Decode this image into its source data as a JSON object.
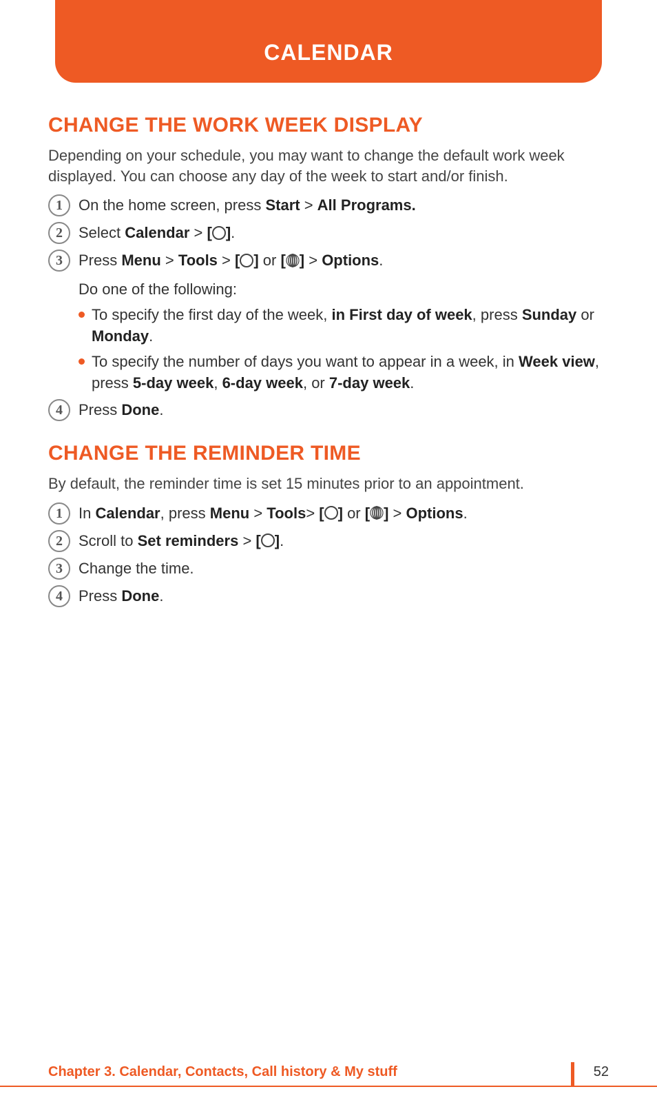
{
  "header": {
    "title": "CALENDAR"
  },
  "section1": {
    "title": "CHANGE THE WORK WEEK DISPLAY",
    "intro": "Depending on your schedule, you may want to change the default work week displayed. You can choose any day of the week to start and/or finish.",
    "steps": {
      "s1": {
        "num": "1",
        "pre": "On the home screen, press ",
        "b1": "Start",
        "mid": " > ",
        "b2": "All Programs."
      },
      "s2": {
        "num": "2",
        "pre": "Select ",
        "b1": "Calendar",
        "mid": " > ",
        "lb": "[",
        "rb": "]",
        "post": "."
      },
      "s3": {
        "num": "3",
        "pre": "Press ",
        "b1": "Menu",
        "g1": " > ",
        "b2": "Tools",
        "g2": " > ",
        "lb1": "[",
        "rb1": "]",
        "or": " or ",
        "lb2": "[",
        "rb2": "]",
        "g3": " > ",
        "b3": "Options",
        "post": "."
      },
      "sub": "Do one of the following:",
      "bullet1": {
        "pre": "To specify the first day of the week, ",
        "b1": "in First day of week",
        "mid": ", press ",
        "b2": "Sunday",
        "or": " or ",
        "b3": "Monday",
        "post": "."
      },
      "bullet2": {
        "pre": "To specify the number of days you want to appear in a week, in ",
        "b1": "Week view",
        "mid": ", press ",
        "b2": "5-day week",
        "c1": ", ",
        "b3": "6-day week",
        "c2": ", or ",
        "b4": "7-day week",
        "post": "."
      },
      "s4": {
        "num": "4",
        "pre": "Press ",
        "b1": "Done",
        "post": "."
      }
    }
  },
  "section2": {
    "title": "CHANGE THE REMINDER TIME",
    "intro": "By default, the reminder time is set 15 minutes prior to an appointment.",
    "steps": {
      "s1": {
        "num": "1",
        "pre": "In ",
        "b0": "Calendar",
        "mid0": ", press ",
        "b1": "Menu",
        "g1": " > ",
        "b2": "Tools",
        "g2": "> ",
        "lb1": "[",
        "rb1": "]",
        "or": " or ",
        "lb2": "[",
        "rb2": "]",
        "g3": " > ",
        "b3": "Options",
        "post": "."
      },
      "s2": {
        "num": "2",
        "pre": "Scroll to ",
        "b1": "Set reminders",
        "mid": " > ",
        "lb": "[",
        "rb": "]",
        "post": "."
      },
      "s3": {
        "num": "3",
        "text": "Change the time."
      },
      "s4": {
        "num": "4",
        "pre": "Press ",
        "b1": "Done",
        "post": "."
      }
    }
  },
  "footer": {
    "chapter": "Chapter 3. Calendar, Contacts, Call history & My stuff",
    "page": "52"
  }
}
